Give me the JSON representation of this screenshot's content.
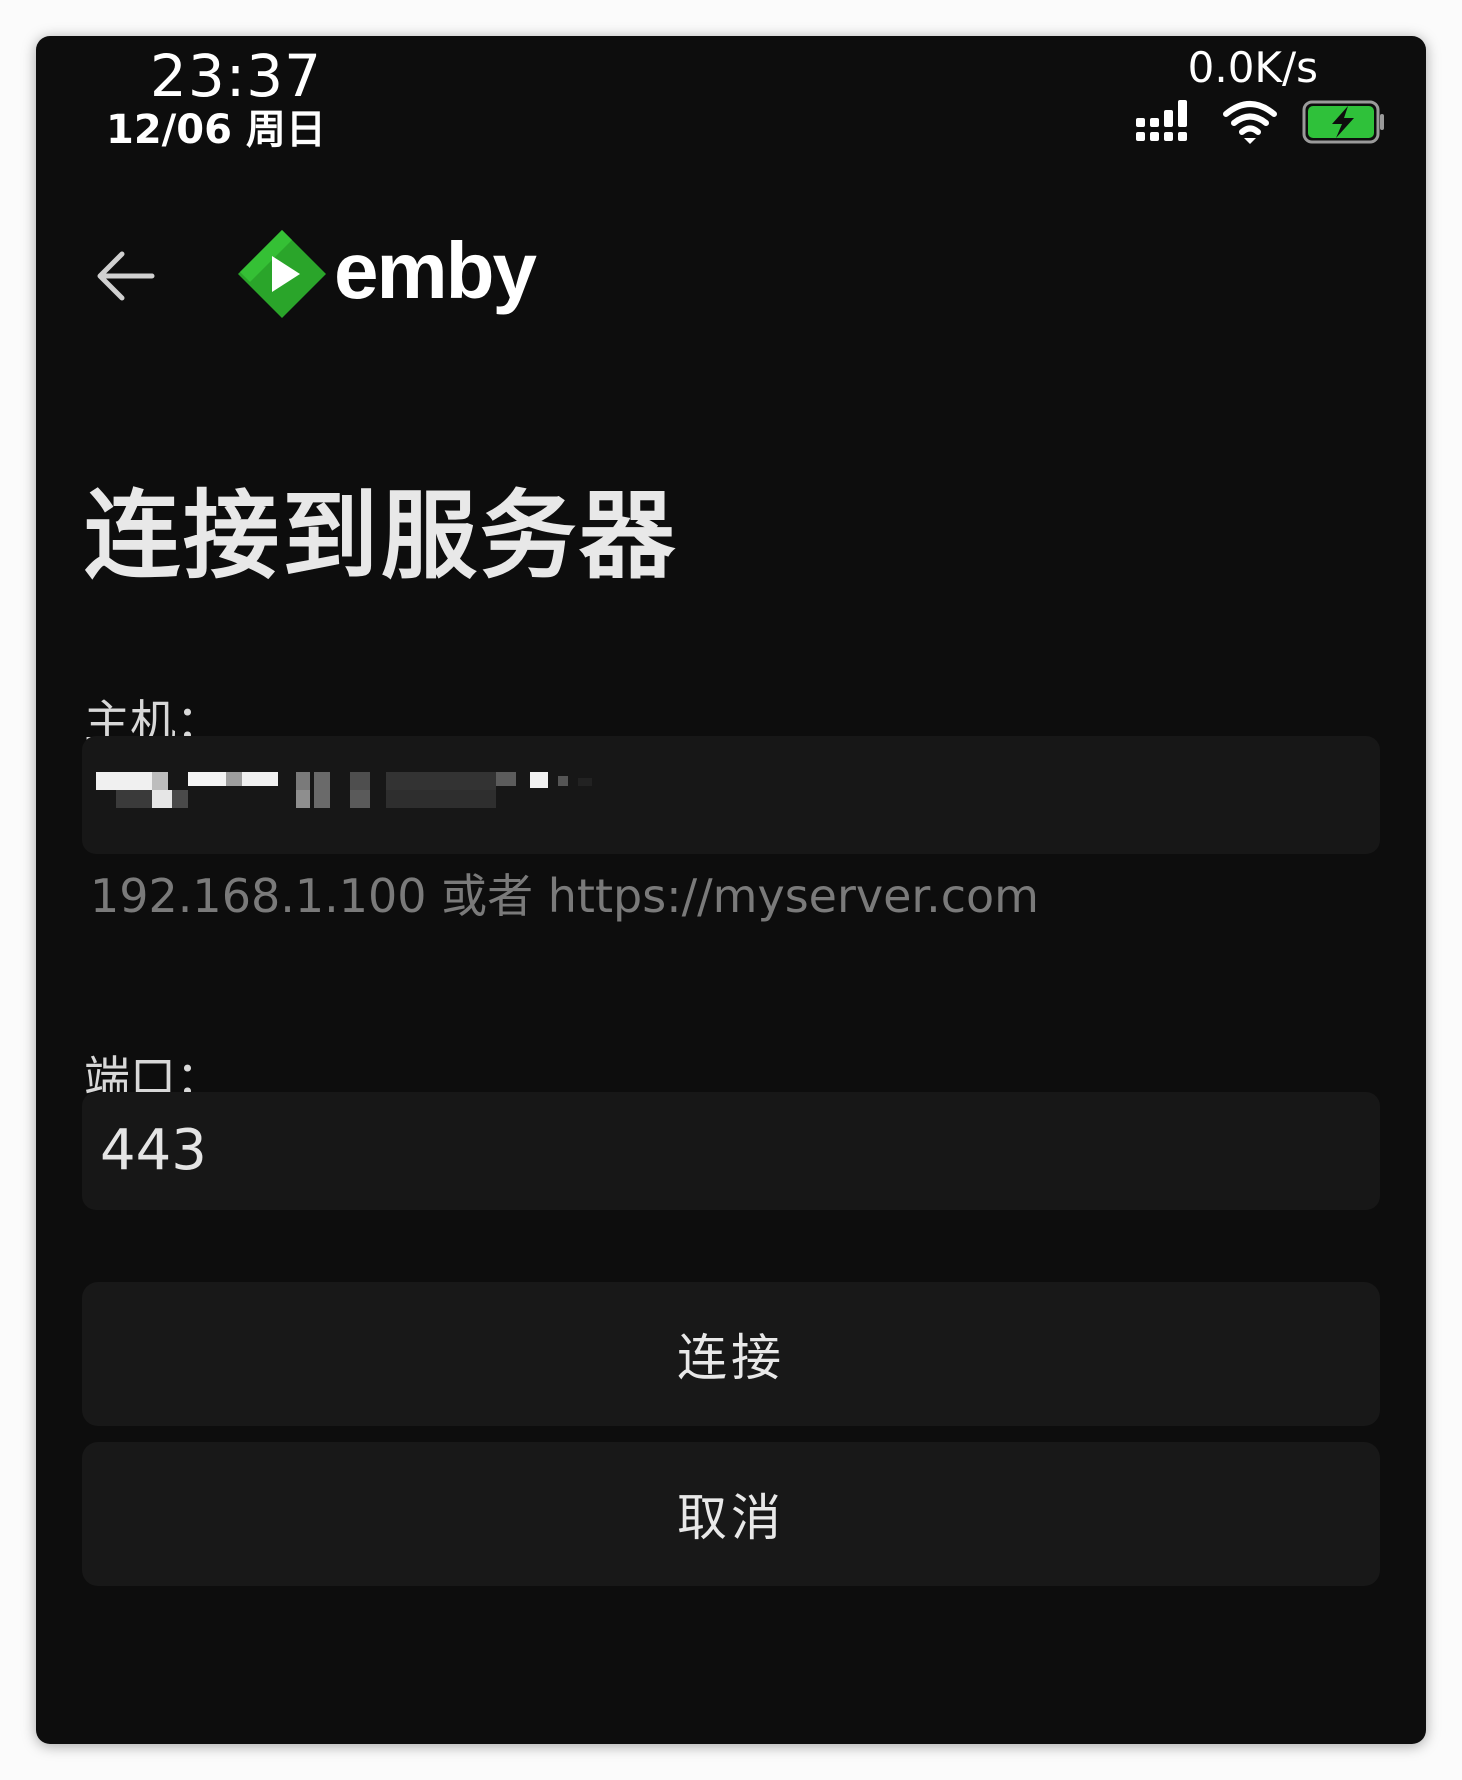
{
  "status_bar": {
    "time": "23:37",
    "date": "12/06 周日",
    "net_speed": "0.0K/s",
    "icons": [
      "signal-icon",
      "wifi-icon",
      "battery-charging-icon"
    ],
    "battery_color": "#2fc13a"
  },
  "header": {
    "back_icon": "arrow-left-icon",
    "logo_text": "emby",
    "logo_color": "#2aa52a"
  },
  "page": {
    "title": "连接到服务器"
  },
  "form": {
    "host_label": "主机：",
    "host_value_redacted": true,
    "host_hint": "192.168.1.100 或者 https://myserver.com",
    "port_label": "端口：",
    "port_value": "443"
  },
  "buttons": {
    "connect": "连接",
    "cancel": "取消"
  },
  "colors": {
    "background": "#0d0d0d",
    "field_background": "#171717",
    "button_background": "#181818",
    "hint": "#7a7a7a"
  }
}
